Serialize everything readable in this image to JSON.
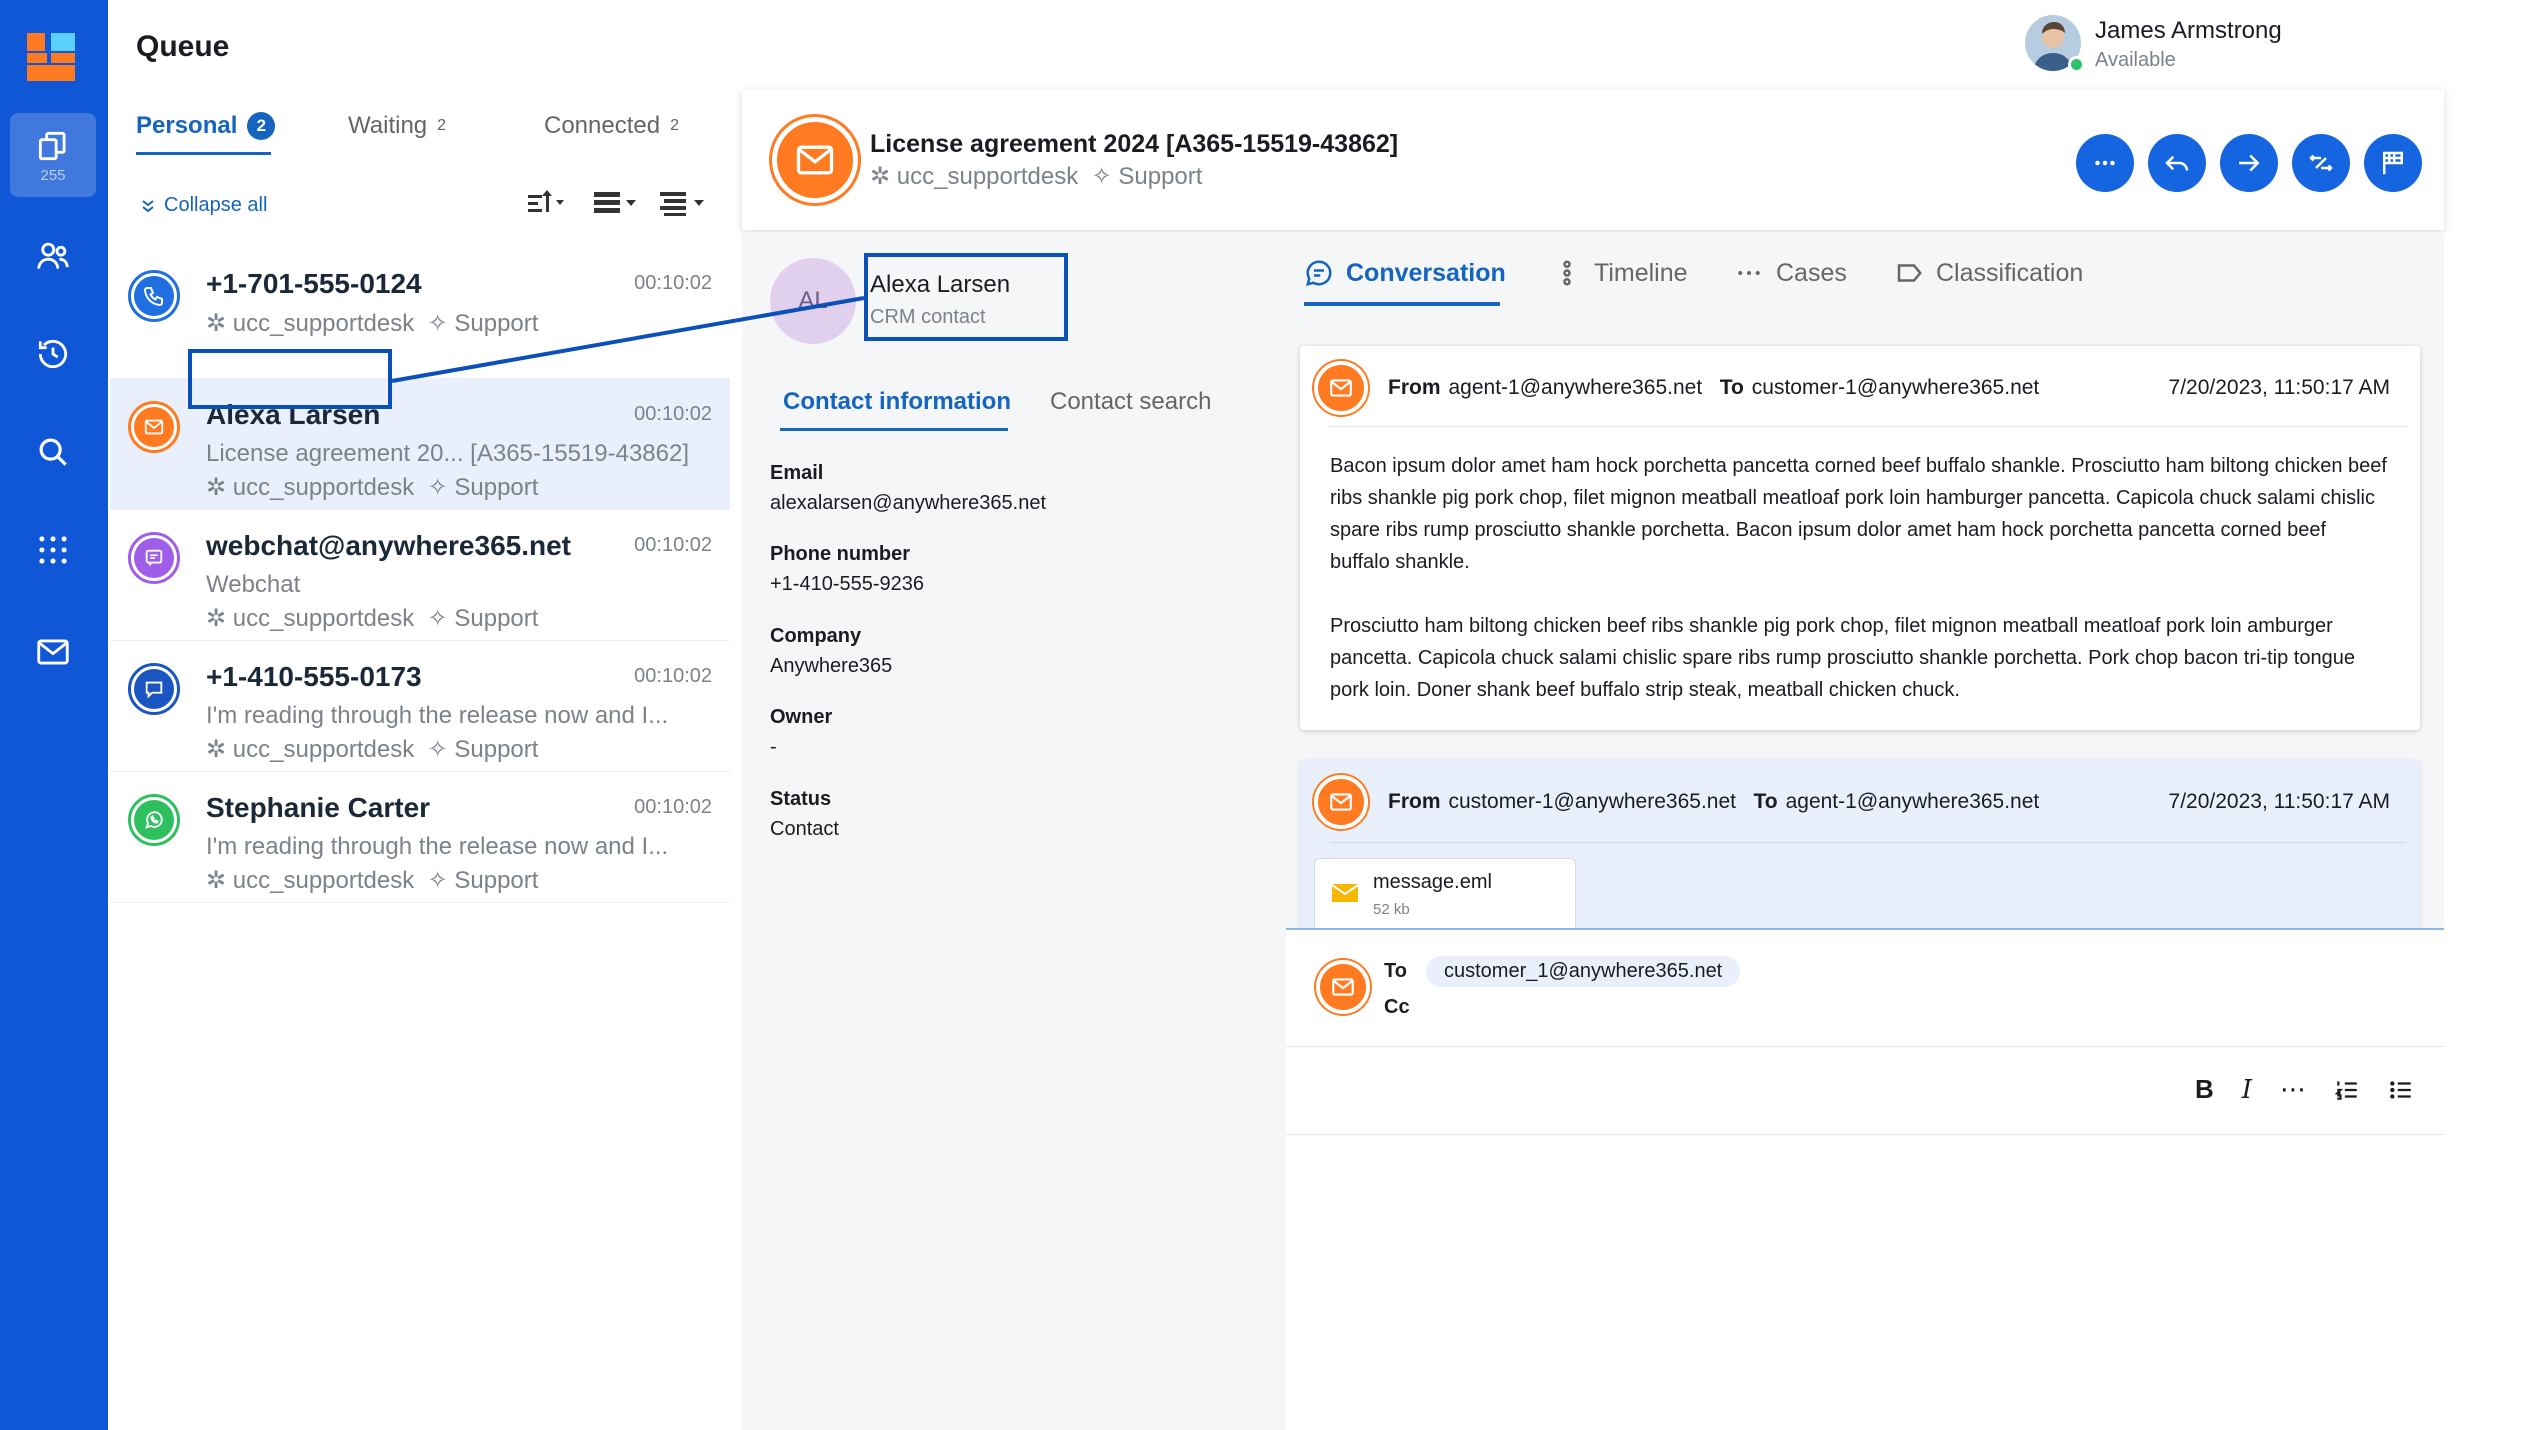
{
  "rail": {
    "active_count": "255"
  },
  "queue": {
    "title": "Queue",
    "tabs": [
      {
        "label": "Personal",
        "count": "2"
      },
      {
        "label": "Waiting",
        "count": "2"
      },
      {
        "label": "Connected",
        "count": "2"
      }
    ],
    "collapse_label": "Collapse all",
    "items": [
      {
        "name": "+1-701-555-0124",
        "subtitle": "",
        "queue": "ucc_supportdesk",
        "skill": "Support",
        "time": "00:10:02",
        "channel": "phone",
        "color": "#1f6fe0"
      },
      {
        "name": "Alexa Larsen",
        "subtitle": "License agreement 20... [A365-15519-43862]",
        "queue": "ucc_supportdesk",
        "skill": "Support",
        "time": "00:10:02",
        "channel": "email",
        "color": "#ff7a21"
      },
      {
        "name": "webchat@anywhere365.net",
        "subtitle": "Webchat",
        "queue": "ucc_supportdesk",
        "skill": "Support",
        "time": "00:10:02",
        "channel": "webchat",
        "color": "#a05ee8"
      },
      {
        "name": "+1-410-555-0173",
        "subtitle": "I'm reading through the release now and I...",
        "queue": "ucc_supportdesk",
        "skill": "Support",
        "time": "00:10:02",
        "channel": "chat",
        "color": "#1b55c2"
      },
      {
        "name": "Stephanie Carter",
        "subtitle": "I'm reading through the release now and I...",
        "queue": "ucc_supportdesk",
        "skill": "Support",
        "time": "00:10:02",
        "channel": "whatsapp",
        "color": "#2ec05e"
      }
    ]
  },
  "user": {
    "name": "James Armstrong",
    "status": "Available"
  },
  "header": {
    "title": "License agreement 2024 [A365-15519-43862]",
    "queue": "ucc_supportdesk",
    "skill": "Support"
  },
  "contact": {
    "initials": "AL",
    "name": "Alexa Larsen",
    "type": "CRM contact",
    "tabs": [
      "Contact information",
      "Contact search"
    ],
    "fields": [
      {
        "label": "Email",
        "value": "alexalarsen@anywhere365.net"
      },
      {
        "label": "Phone number",
        "value": "+1-410-555-9236"
      },
      {
        "label": "Company",
        "value": "Anywhere365"
      },
      {
        "label": "Owner",
        "value": "-"
      },
      {
        "label": "Status",
        "value": "Contact"
      }
    ]
  },
  "conversation": {
    "tabs": [
      "Conversation",
      "Timeline",
      "Cases",
      "Classification"
    ],
    "messages": [
      {
        "from_label": "From",
        "from": "agent-1@anywhere365.net",
        "to_label": "To",
        "to": "customer-1@anywhere365.net",
        "date": "7/20/2023, 11:50:17 AM",
        "paragraphs": [
          "Bacon ipsum dolor amet ham hock porchetta pancetta corned beef buffalo shankle. Prosciutto ham biltong chicken beef ribs shankle pig pork chop, filet mignon meatball meatloaf pork loin hamburger pancetta. Capicola chuck salami chislic spare ribs rump prosciutto shankle porchetta. Bacon ipsum dolor amet ham hock porchetta pancetta corned beef buffalo shankle.",
          "Prosciutto ham biltong chicken beef ribs shankle pig pork chop, filet mignon meatball meatloaf pork loin amburger pancetta. Capicola chuck salami chislic spare ribs rump prosciutto shankle porchetta. Pork chop bacon tri-tip tongue pork loin. Doner shank beef buffalo strip steak, meatball chicken chuck."
        ]
      },
      {
        "from_label": "From",
        "from": "customer-1@anywhere365.net",
        "to_label": "To",
        "to": "agent-1@anywhere365.net",
        "date": "7/20/2023, 11:50:17 AM",
        "attachment": {
          "name": "message.eml",
          "size": "52 kb"
        }
      }
    ],
    "reply": {
      "to_label": "To",
      "to": "customer_1@anywhere365.net",
      "cc_label": "Cc"
    }
  }
}
